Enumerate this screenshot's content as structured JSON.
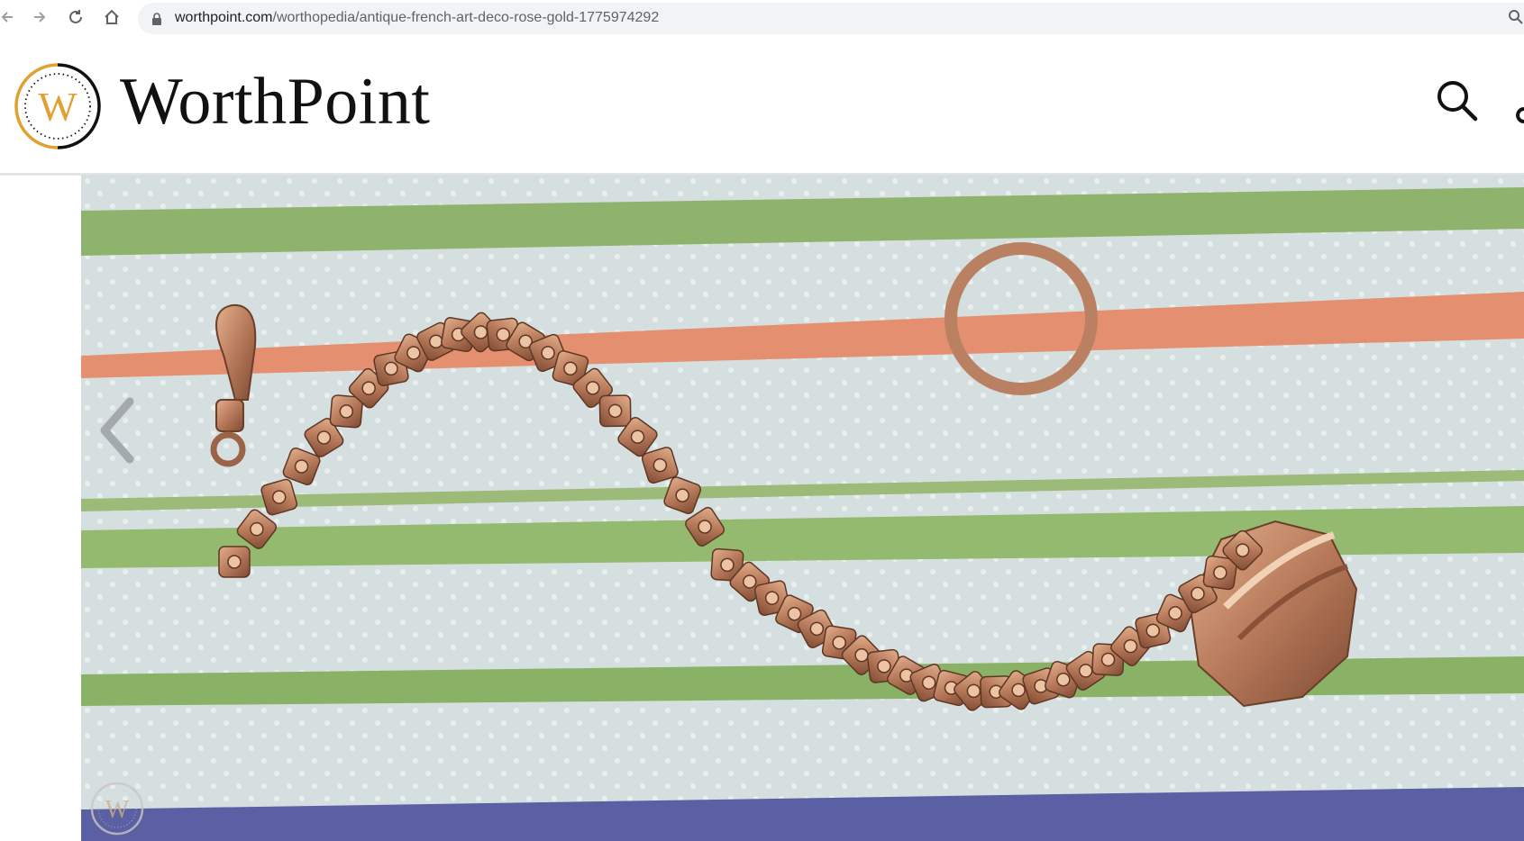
{
  "browser": {
    "url_host": "worthpoint.com",
    "url_path": "/worthopedia/antique-french-art-deco-rose-gold-1775974292",
    "icons": [
      "back-icon",
      "forward-icon",
      "reload-icon",
      "home-icon",
      "lock-icon",
      "zoom-icon"
    ]
  },
  "header": {
    "logo_letter": "W",
    "logo_text": "WorthPoint",
    "icons": [
      "search-icon",
      "user-icon"
    ]
  },
  "carousel": {
    "icons": [
      "chevron-left-icon"
    ],
    "watermark_letter": "W"
  },
  "colors": {
    "brand_gold": "#e0a132",
    "ink": "#111111",
    "stripe_green": "#8ab56a",
    "stripe_salmon": "#e38b6e",
    "stripe_blue": "#5a5aa0",
    "cloth": "#d9e2e2",
    "chain": "#a46a4c"
  }
}
